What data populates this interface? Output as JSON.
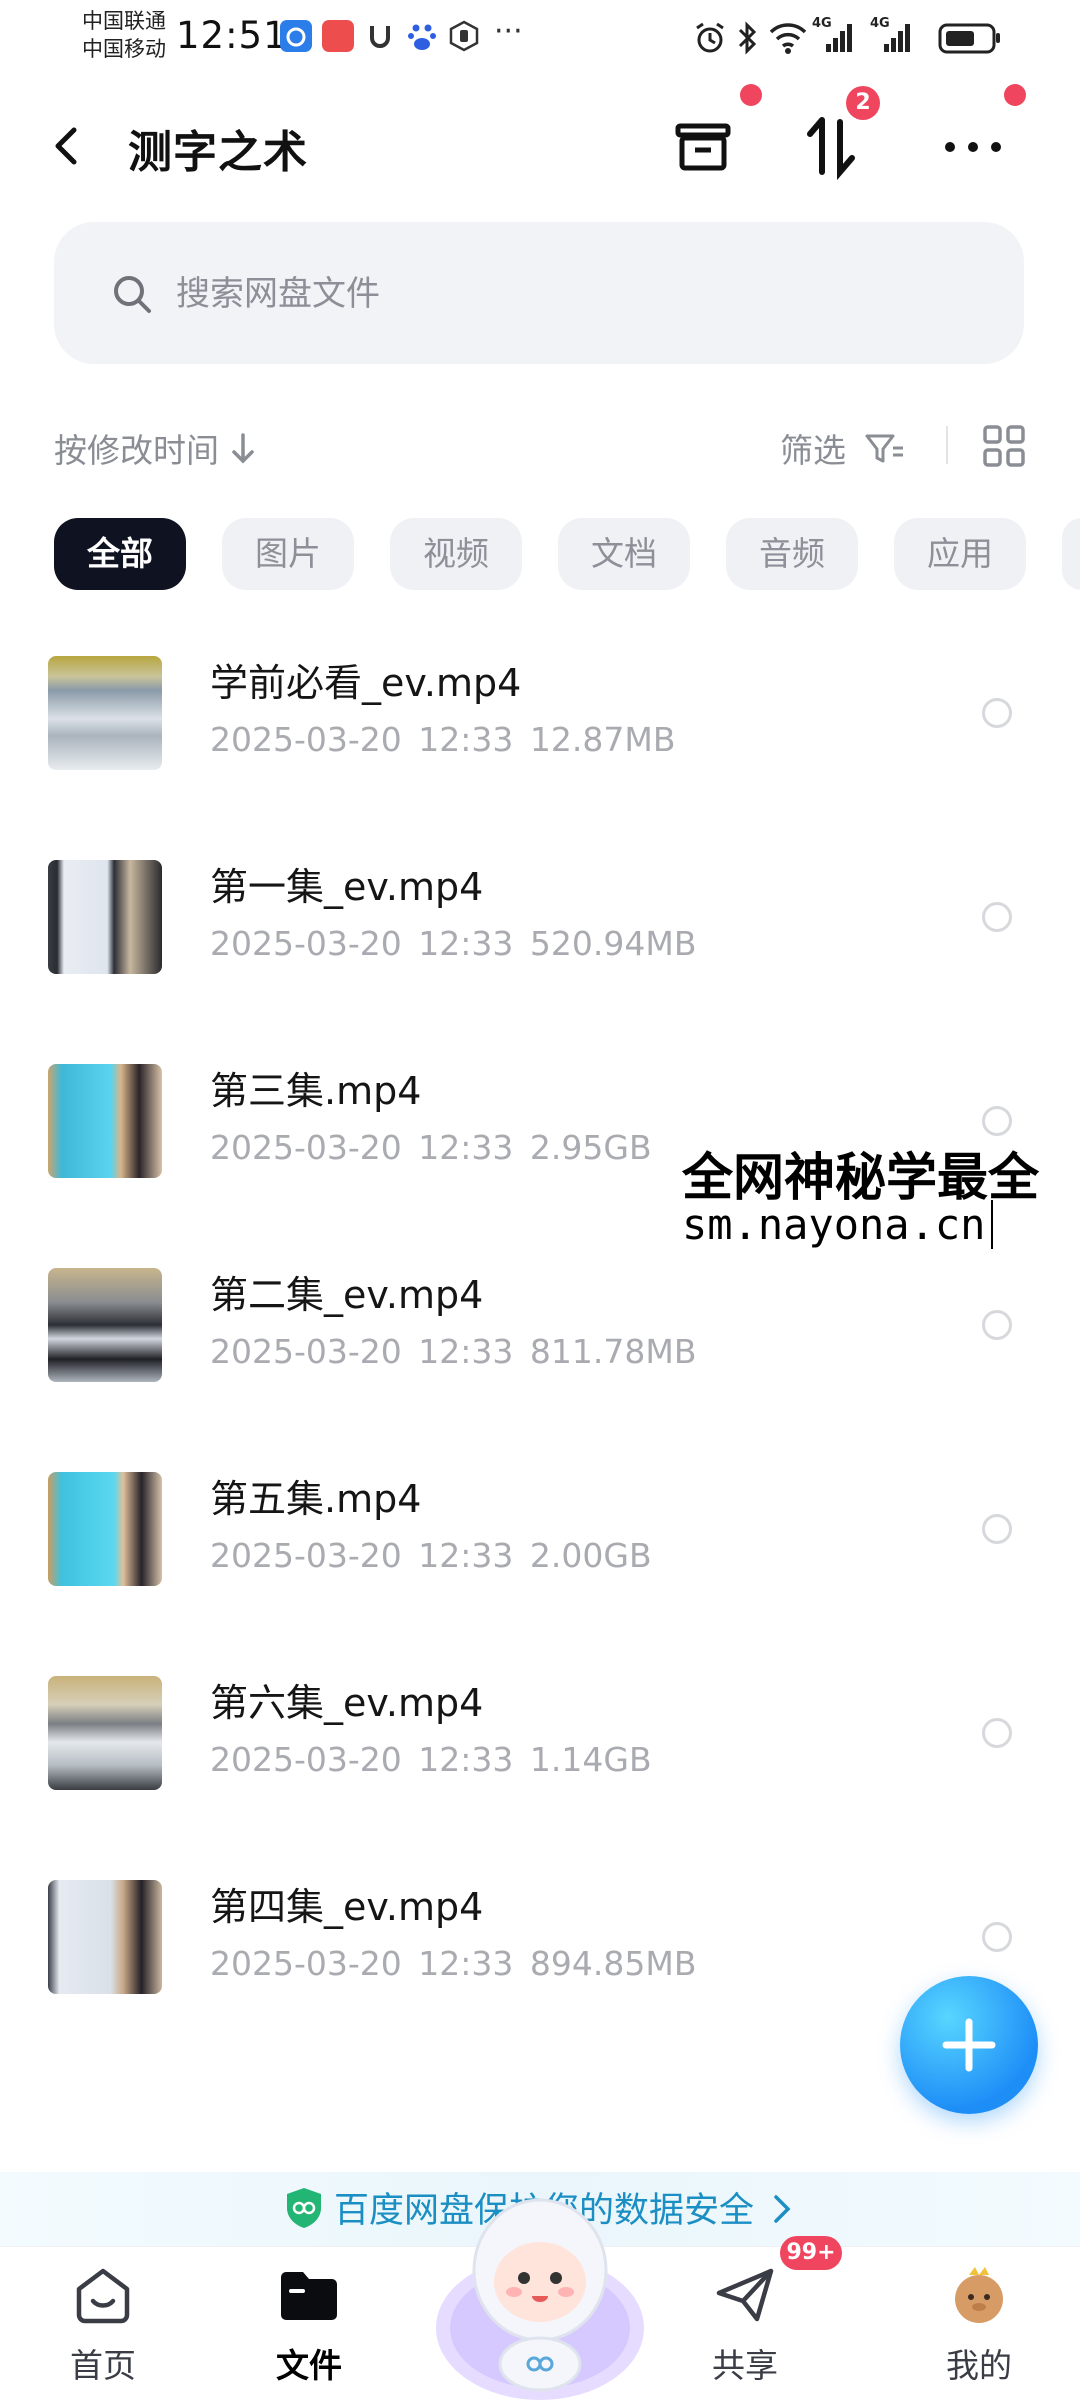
{
  "status_bar": {
    "carrier1": "中国联通",
    "carrier2": "中国移动",
    "time": "12:51",
    "more": "···",
    "signal1": "4G",
    "signal2": "4G"
  },
  "header": {
    "title": "测字之术",
    "transfer_badge": "2"
  },
  "search": {
    "placeholder": "搜索网盘文件"
  },
  "toolbar": {
    "sort_label": "按修改时间",
    "filter_label": "筛选"
  },
  "filter_chips": [
    {
      "label": "全部",
      "active": true
    },
    {
      "label": "图片",
      "active": false
    },
    {
      "label": "视频",
      "active": false
    },
    {
      "label": "文档",
      "active": false
    },
    {
      "label": "音频",
      "active": false
    },
    {
      "label": "应用",
      "active": false
    }
  ],
  "files": [
    {
      "name": "学前必看_ev.mp4",
      "date": "2025-03-20",
      "time": "12:33",
      "size": "12.87MB"
    },
    {
      "name": "第一集_ev.mp4",
      "date": "2025-03-20",
      "time": "12:33",
      "size": "520.94MB"
    },
    {
      "name": "第三集.mp4",
      "date": "2025-03-20",
      "time": "12:33",
      "size": "2.95GB"
    },
    {
      "name": "第二集_ev.mp4",
      "date": "2025-03-20",
      "time": "12:33",
      "size": "811.78MB"
    },
    {
      "name": "第五集.mp4",
      "date": "2025-03-20",
      "time": "12:33",
      "size": "2.00GB"
    },
    {
      "name": "第六集_ev.mp4",
      "date": "2025-03-20",
      "time": "12:33",
      "size": "1.14GB"
    },
    {
      "name": "第四集_ev.mp4",
      "date": "2025-03-20",
      "time": "12:33",
      "size": "894.85MB"
    }
  ],
  "watermark": {
    "line1": "全网神秘学最全",
    "line2": "sm.nayona.cn"
  },
  "banner": {
    "text": "百度网盘保护您的数据安全"
  },
  "bottom_nav": {
    "items": [
      {
        "label": "首页"
      },
      {
        "label": "文件"
      },
      {
        "label": "共享"
      },
      {
        "label": "我的"
      }
    ],
    "share_badge": "99+"
  },
  "colors": {
    "accent_blue": "#1e8ef7",
    "badge_red": "#f0455e",
    "chip_active": "#0e1221"
  }
}
